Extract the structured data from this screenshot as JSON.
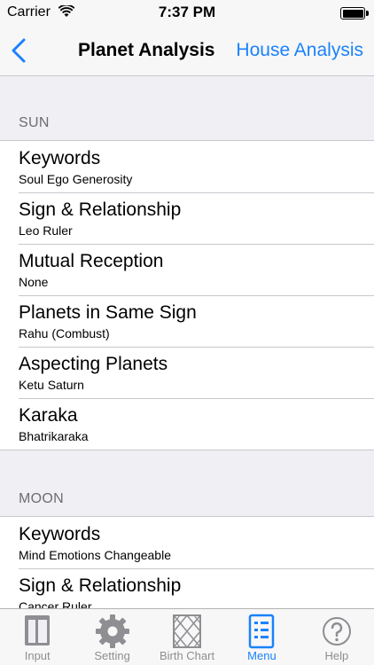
{
  "status_bar": {
    "carrier": "Carrier",
    "time": "7:37 PM"
  },
  "nav": {
    "title": "Planet Analysis",
    "right_label": "House Analysis"
  },
  "sections": [
    {
      "header": "SUN",
      "rows": [
        {
          "title": "Keywords",
          "subtitle": "Soul Ego Generosity"
        },
        {
          "title": "Sign & Relationship",
          "subtitle": "Leo Ruler"
        },
        {
          "title": "Mutual Reception",
          "subtitle": "None"
        },
        {
          "title": "Planets in Same Sign",
          "subtitle": "Rahu (Combust)"
        },
        {
          "title": "Aspecting Planets",
          "subtitle": "Ketu Saturn"
        },
        {
          "title": "Karaka",
          "subtitle": "Bhatrikaraka"
        }
      ]
    },
    {
      "header": "MOON",
      "rows": [
        {
          "title": "Keywords",
          "subtitle": "Mind Emotions Changeable"
        },
        {
          "title": "Sign & Relationship",
          "subtitle": "Cancer Ruler"
        }
      ]
    }
  ],
  "tab_bar": {
    "tabs": [
      {
        "label": "Input",
        "icon": "book-icon"
      },
      {
        "label": "Setting",
        "icon": "gear-icon"
      },
      {
        "label": "Birth Chart",
        "icon": "chart-grid-icon"
      },
      {
        "label": "Menu",
        "icon": "menu-icon",
        "active": true
      },
      {
        "label": "Help",
        "icon": "help-icon"
      }
    ]
  },
  "colors": {
    "accent": "#1a82fb",
    "background": "#efeff4",
    "separator": "#c8c7cc",
    "inactive_tab": "#8e8e93"
  }
}
